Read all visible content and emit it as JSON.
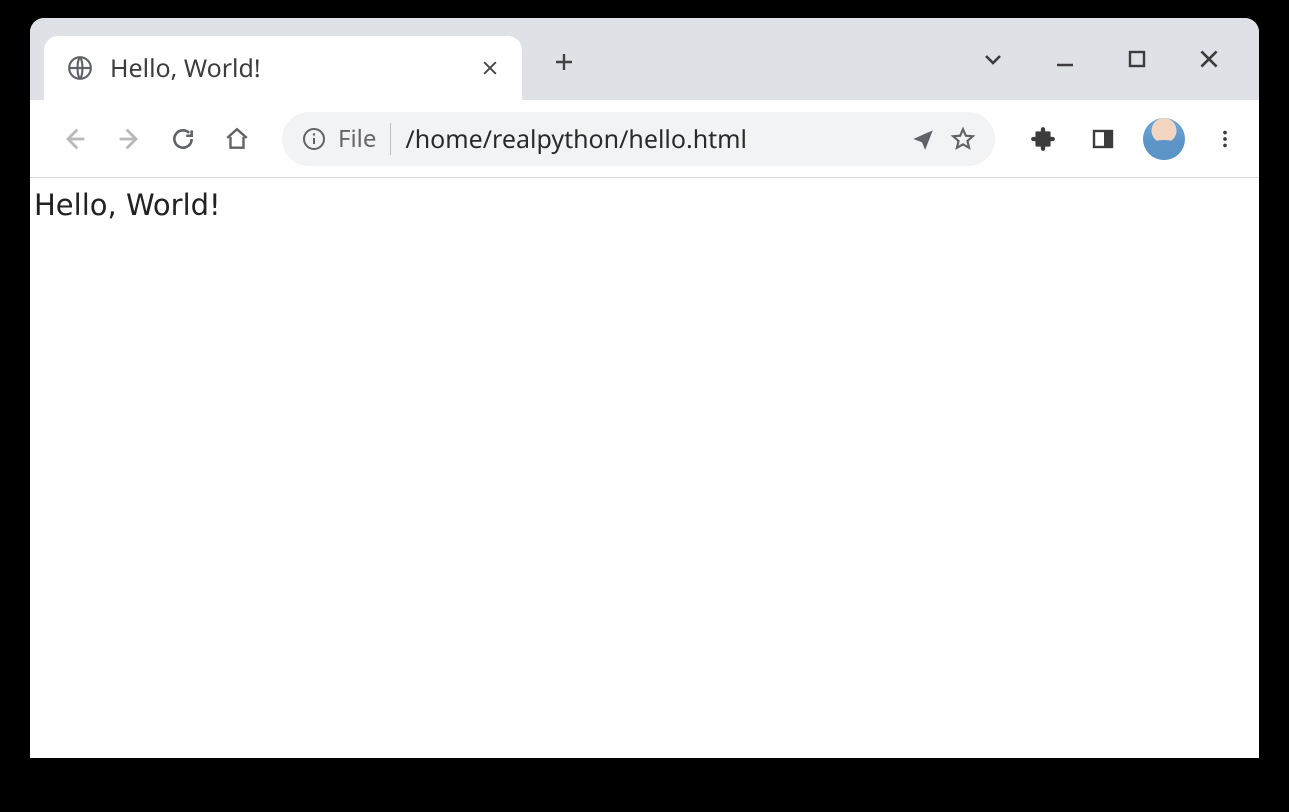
{
  "tabs": [
    {
      "title": "Hello, World!"
    }
  ],
  "omnibox": {
    "scheme_label": "File",
    "url": "/home/realpython/hello.html"
  },
  "page": {
    "body_text": "Hello, World!"
  }
}
